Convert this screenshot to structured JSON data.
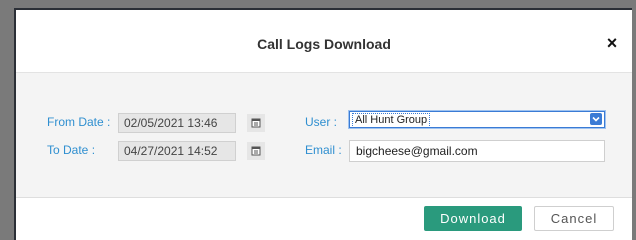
{
  "dialog": {
    "title": "Call Logs Download",
    "close_label": "×"
  },
  "form": {
    "from_date_label": "From Date :",
    "from_date_value": "02/05/2021 13:46",
    "to_date_label": "To Date :",
    "to_date_value": "04/27/2021 14:52",
    "user_label": "User :",
    "user_selected": "All Hunt Group",
    "email_label": "Email :",
    "email_value": "bigcheese@gmail.com"
  },
  "actions": {
    "download_label": "Download",
    "cancel_label": "Cancel"
  },
  "icons": {
    "calendar": "calendar-icon",
    "close": "close-icon",
    "dropdown": "chevron-down-icon"
  },
  "colors": {
    "label": "#2f8fd0",
    "primary_button": "#2a9a7d",
    "select_border": "#3a7bd5"
  }
}
